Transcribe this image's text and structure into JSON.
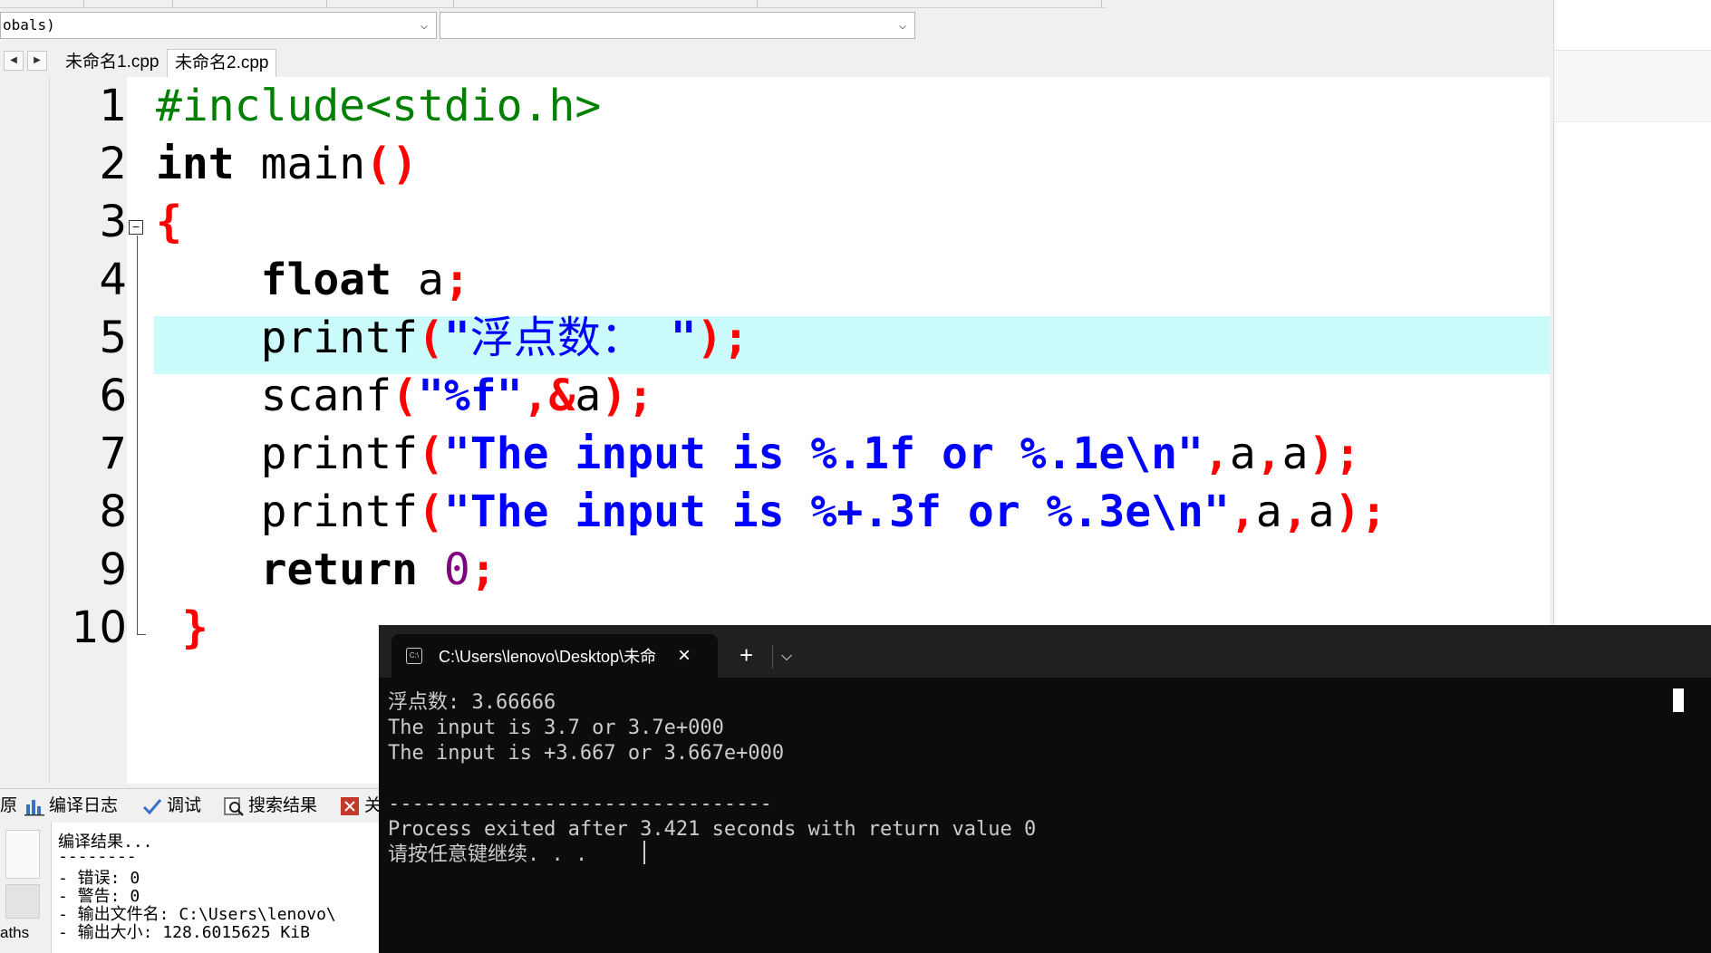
{
  "combo": {
    "scope_value": "obals)",
    "symbol_value": ""
  },
  "tabs": [
    {
      "label": "未命名1.cpp"
    },
    {
      "label": "未命名2.cpp"
    }
  ],
  "editor": {
    "line_numbers": [
      "1",
      "2",
      "3",
      "4",
      "5",
      "6",
      "7",
      "8",
      "9",
      "10"
    ],
    "highlighted_line": 5,
    "lines": [
      [
        {
          "t": "#include<stdio.h>",
          "c": "pre"
        }
      ],
      [
        {
          "t": "int",
          "c": "kw"
        },
        {
          "t": " main",
          "c": "id"
        },
        {
          "t": "()",
          "c": "sym"
        }
      ],
      [
        {
          "t": "{",
          "c": "sym"
        }
      ],
      [
        {
          "t": "    ",
          "c": "id"
        },
        {
          "t": "float",
          "c": "kw"
        },
        {
          "t": " a",
          "c": "id"
        },
        {
          "t": ";",
          "c": "sym"
        }
      ],
      [
        {
          "t": "    printf",
          "c": "id"
        },
        {
          "t": "(",
          "c": "sym"
        },
        {
          "t": "\"",
          "c": "str"
        },
        {
          "t": "浮点数：",
          "c": "strcn"
        },
        {
          "t": " \"",
          "c": "str"
        },
        {
          "t": ");",
          "c": "sym"
        }
      ],
      [
        {
          "t": "    scanf",
          "c": "id"
        },
        {
          "t": "(",
          "c": "sym"
        },
        {
          "t": "\"%f\"",
          "c": "str"
        },
        {
          "t": ",&",
          "c": "sym"
        },
        {
          "t": "a",
          "c": "id"
        },
        {
          "t": ");",
          "c": "sym"
        }
      ],
      [
        {
          "t": "    printf",
          "c": "id"
        },
        {
          "t": "(",
          "c": "sym"
        },
        {
          "t": "\"The input is %.1f or %.1e\\n\"",
          "c": "str"
        },
        {
          "t": ",",
          "c": "sym"
        },
        {
          "t": "a",
          "c": "id"
        },
        {
          "t": ",",
          "c": "sym"
        },
        {
          "t": "a",
          "c": "id"
        },
        {
          "t": ");",
          "c": "sym"
        }
      ],
      [
        {
          "t": "    printf",
          "c": "id"
        },
        {
          "t": "(",
          "c": "sym"
        },
        {
          "t": "\"The input is %+.3f or %.3e\\n\"",
          "c": "str"
        },
        {
          "t": ",",
          "c": "sym"
        },
        {
          "t": "a",
          "c": "id"
        },
        {
          "t": ",",
          "c": "sym"
        },
        {
          "t": "a",
          "c": "id"
        },
        {
          "t": ");",
          "c": "sym"
        }
      ],
      [
        {
          "t": "    ",
          "c": "id"
        },
        {
          "t": "return",
          "c": "kw"
        },
        {
          "t": " ",
          "c": "id"
        },
        {
          "t": "0",
          "c": "num"
        },
        {
          "t": ";",
          "c": "sym"
        }
      ],
      [
        {
          "t": " ",
          "c": "id"
        },
        {
          "t": "}",
          "c": "sym"
        }
      ]
    ]
  },
  "bottom_tabs": {
    "partial_left": "原",
    "compile_log": "编译日志",
    "debug": "调试",
    "search_results": "搜索结果",
    "partial_right": "关"
  },
  "compile_log": {
    "side_label": "aths",
    "lines": [
      "编译结果...",
      "--------",
      "- 错误: 0",
      "- 警告: 0",
      "- 输出文件名: C:\\Users\\lenovo\\",
      "- 输出大小: 128.6015625 KiB"
    ]
  },
  "terminal": {
    "tab_title": "C:\\Users\\lenovo\\Desktop\\未命",
    "lines": [
      "浮点数: 3.66666",
      "The input is 3.7 or 3.7e+000",
      "The input is +3.667 or 3.667e+000",
      "",
      "--------------------------------",
      "Process exited after 3.421 seconds with return value 0",
      "请按任意键继续. . ."
    ]
  },
  "colors": {
    "preprocessor": "#008000",
    "keyword": "#000000",
    "symbol": "#ff0000",
    "string": "#0000ff",
    "number": "#800080",
    "highlight": "#cbfbfb",
    "terminal_bg": "#0c0c0c"
  }
}
